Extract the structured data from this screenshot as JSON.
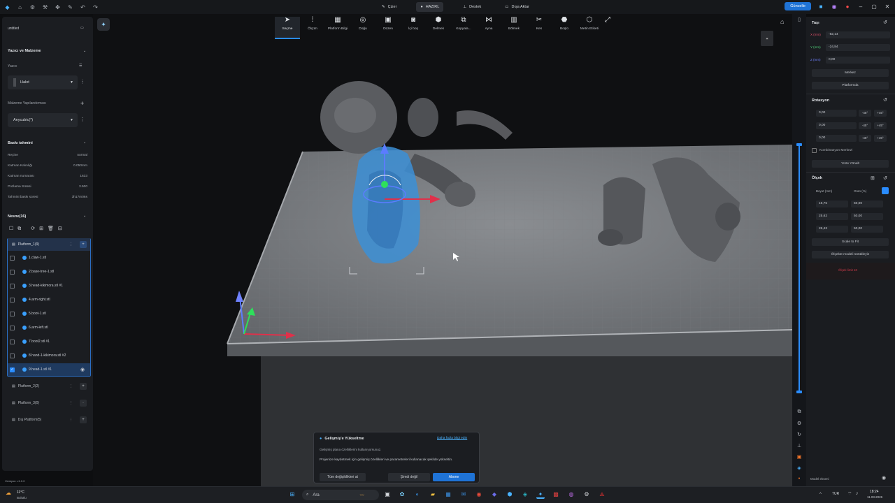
{
  "titlebar": {
    "tabs": [
      {
        "label": "Çizer",
        "icon": "pencil-icon"
      },
      {
        "label": "HAZIRL",
        "icon": "printer-icon"
      },
      {
        "label": "Destek",
        "icon": "support-icon"
      },
      {
        "label": "Dışa Aktar",
        "icon": "export-icon"
      }
    ],
    "update_label": "Güncelle"
  },
  "left": {
    "doc_title": "untitled",
    "printer_section": "Yazıcı ve Malzeme",
    "printer_label": "Yazıcı",
    "printer_value": "Halot",
    "material_label": "Malzeme Yapılandırması",
    "material_value": "Anycubic(*)",
    "estimate_section": "Baskı tahmini",
    "stats": [
      {
        "label": "Reçine",
        "value": "normal"
      },
      {
        "label": "Katman Kalınlığı",
        "value": "0.050mm"
      },
      {
        "label": "Katman numarası",
        "value": "1633"
      },
      {
        "label": "Pozlama Süresi",
        "value": "3.500"
      },
      {
        "label": "Tahmini baskı süresi",
        "value": "3h17m06s"
      }
    ],
    "objects_section": "Nesne(16)",
    "platform1": "Platform_1(9)",
    "objects": [
      "1.claw-1.stl",
      "2.base-tree-1.stl",
      "3.head-kikimora.stl #1",
      "4.arm-right.stl",
      "5.boot-1.stl",
      "6.arm-left.stl",
      "7.boot2.stl #1",
      "8.hand-1-kikimora.stl #2",
      "9.head-1.stl #1"
    ],
    "platforms": [
      "Platform_2(2)",
      "Platform_3(0)",
      "Dış Platform(5)"
    ],
    "version": "Versiyon: v1.0.0"
  },
  "toolbar": {
    "tools": [
      {
        "label": "Seçme",
        "icon": "cursor-icon"
      },
      {
        "label": "Ölçüm",
        "icon": "measure-icon"
      },
      {
        "label": "Platform Bilgi",
        "icon": "platform-icon"
      },
      {
        "label": "Doğu",
        "icon": "orient-icon"
      },
      {
        "label": "Düzen",
        "icon": "layout-icon"
      },
      {
        "label": "İçi boş",
        "icon": "hollow-icon"
      },
      {
        "label": "Delmek",
        "icon": "drill-icon"
      },
      {
        "label": "Kopyala...",
        "icon": "copy-icon"
      },
      {
        "label": "Ayna",
        "icon": "mirror-icon"
      },
      {
        "label": "Bölmek",
        "icon": "split-icon"
      },
      {
        "label": "Kes",
        "icon": "cut-icon"
      },
      {
        "label": "Boşlo",
        "icon": "support-tool-icon"
      },
      {
        "label": "Metin Etiketi",
        "icon": "text-label-icon"
      }
    ]
  },
  "right": {
    "move_section": "Taşı",
    "x_value": "-82,14",
    "y_value": "-24,84",
    "z_value": "0,00",
    "unit_x": "X (mm)",
    "unit_y": "Y (mm)",
    "unit_z": "Z (mm)",
    "center_btn": "Merkez",
    "platform_btn": "Platformda",
    "rotation_section": "Rotasyon",
    "rot": [
      "0,00",
      "0,00",
      "0,00"
    ],
    "rot_minus": "-45°",
    "rot_plus": "+45°",
    "combo_center": "Kombinasyon Merkezi",
    "face_orient": "Yüze Yönelt",
    "scale_section": "Ölçek",
    "size_label": "Boyut (mm)",
    "ratio_label": "Oran (%)",
    "sizes": [
      "16,75",
      "25,62",
      "26,43"
    ],
    "ratios": [
      "50,00",
      "50,00",
      "50,00"
    ],
    "scale_fit": "Scale to Fit",
    "scale_model": "Ölçekte modeli sürükleyin",
    "warning": "Ölçek limit 10",
    "model_label": "Model ekseni"
  },
  "dialog": {
    "title": "Gelişmiş'e Yükseltme",
    "link": "Daha fazla bilgi edin",
    "line1": "Gelişmiş plana özelliklerini kullanıyorsunuz.",
    "line2": "Projenize kaydetmek için gelişmiş özellikleri ve parametreleri kullanacak şekilde yükseltin.",
    "btn_all": "Tüm değişiklikleri at",
    "btn_later": "Şimdi değil",
    "btn_subscribe": "Abone"
  },
  "taskbar": {
    "weather_temp": "11°C",
    "weather_desc": "Bulutlu",
    "search_placeholder": "Ara",
    "lang": "TUR",
    "time": "18:24",
    "date": "11.03.2026"
  }
}
